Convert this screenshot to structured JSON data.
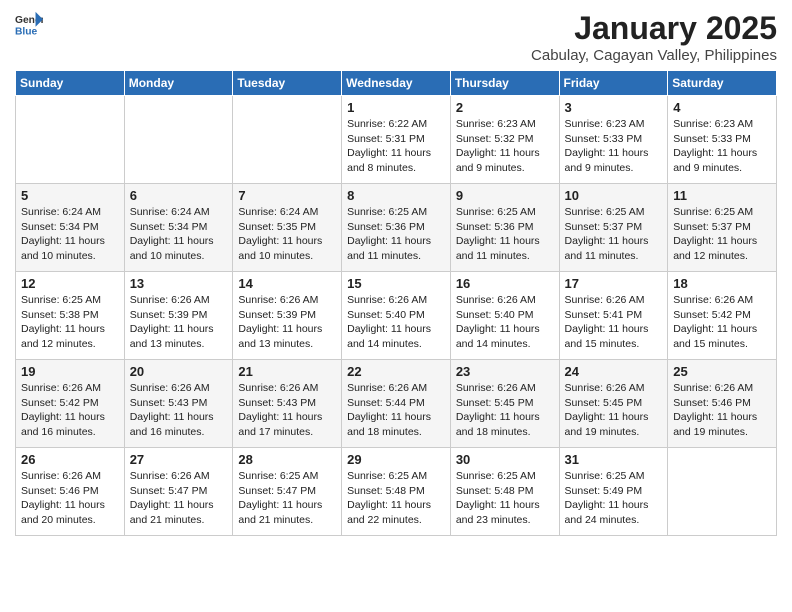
{
  "header": {
    "logo_line1": "General",
    "logo_line2": "Blue",
    "month": "January 2025",
    "location": "Cabulay, Cagayan Valley, Philippines"
  },
  "weekdays": [
    "Sunday",
    "Monday",
    "Tuesday",
    "Wednesday",
    "Thursday",
    "Friday",
    "Saturday"
  ],
  "weeks": [
    [
      {
        "day": "",
        "content": ""
      },
      {
        "day": "",
        "content": ""
      },
      {
        "day": "",
        "content": ""
      },
      {
        "day": "1",
        "content": "Sunrise: 6:22 AM\nSunset: 5:31 PM\nDaylight: 11 hours and 8 minutes."
      },
      {
        "day": "2",
        "content": "Sunrise: 6:23 AM\nSunset: 5:32 PM\nDaylight: 11 hours and 9 minutes."
      },
      {
        "day": "3",
        "content": "Sunrise: 6:23 AM\nSunset: 5:33 PM\nDaylight: 11 hours and 9 minutes."
      },
      {
        "day": "4",
        "content": "Sunrise: 6:23 AM\nSunset: 5:33 PM\nDaylight: 11 hours and 9 minutes."
      }
    ],
    [
      {
        "day": "5",
        "content": "Sunrise: 6:24 AM\nSunset: 5:34 PM\nDaylight: 11 hours and 10 minutes."
      },
      {
        "day": "6",
        "content": "Sunrise: 6:24 AM\nSunset: 5:34 PM\nDaylight: 11 hours and 10 minutes."
      },
      {
        "day": "7",
        "content": "Sunrise: 6:24 AM\nSunset: 5:35 PM\nDaylight: 11 hours and 10 minutes."
      },
      {
        "day": "8",
        "content": "Sunrise: 6:25 AM\nSunset: 5:36 PM\nDaylight: 11 hours and 11 minutes."
      },
      {
        "day": "9",
        "content": "Sunrise: 6:25 AM\nSunset: 5:36 PM\nDaylight: 11 hours and 11 minutes."
      },
      {
        "day": "10",
        "content": "Sunrise: 6:25 AM\nSunset: 5:37 PM\nDaylight: 11 hours and 11 minutes."
      },
      {
        "day": "11",
        "content": "Sunrise: 6:25 AM\nSunset: 5:37 PM\nDaylight: 11 hours and 12 minutes."
      }
    ],
    [
      {
        "day": "12",
        "content": "Sunrise: 6:25 AM\nSunset: 5:38 PM\nDaylight: 11 hours and 12 minutes."
      },
      {
        "day": "13",
        "content": "Sunrise: 6:26 AM\nSunset: 5:39 PM\nDaylight: 11 hours and 13 minutes."
      },
      {
        "day": "14",
        "content": "Sunrise: 6:26 AM\nSunset: 5:39 PM\nDaylight: 11 hours and 13 minutes."
      },
      {
        "day": "15",
        "content": "Sunrise: 6:26 AM\nSunset: 5:40 PM\nDaylight: 11 hours and 14 minutes."
      },
      {
        "day": "16",
        "content": "Sunrise: 6:26 AM\nSunset: 5:40 PM\nDaylight: 11 hours and 14 minutes."
      },
      {
        "day": "17",
        "content": "Sunrise: 6:26 AM\nSunset: 5:41 PM\nDaylight: 11 hours and 15 minutes."
      },
      {
        "day": "18",
        "content": "Sunrise: 6:26 AM\nSunset: 5:42 PM\nDaylight: 11 hours and 15 minutes."
      }
    ],
    [
      {
        "day": "19",
        "content": "Sunrise: 6:26 AM\nSunset: 5:42 PM\nDaylight: 11 hours and 16 minutes."
      },
      {
        "day": "20",
        "content": "Sunrise: 6:26 AM\nSunset: 5:43 PM\nDaylight: 11 hours and 16 minutes."
      },
      {
        "day": "21",
        "content": "Sunrise: 6:26 AM\nSunset: 5:43 PM\nDaylight: 11 hours and 17 minutes."
      },
      {
        "day": "22",
        "content": "Sunrise: 6:26 AM\nSunset: 5:44 PM\nDaylight: 11 hours and 18 minutes."
      },
      {
        "day": "23",
        "content": "Sunrise: 6:26 AM\nSunset: 5:45 PM\nDaylight: 11 hours and 18 minutes."
      },
      {
        "day": "24",
        "content": "Sunrise: 6:26 AM\nSunset: 5:45 PM\nDaylight: 11 hours and 19 minutes."
      },
      {
        "day": "25",
        "content": "Sunrise: 6:26 AM\nSunset: 5:46 PM\nDaylight: 11 hours and 19 minutes."
      }
    ],
    [
      {
        "day": "26",
        "content": "Sunrise: 6:26 AM\nSunset: 5:46 PM\nDaylight: 11 hours and 20 minutes."
      },
      {
        "day": "27",
        "content": "Sunrise: 6:26 AM\nSunset: 5:47 PM\nDaylight: 11 hours and 21 minutes."
      },
      {
        "day": "28",
        "content": "Sunrise: 6:25 AM\nSunset: 5:47 PM\nDaylight: 11 hours and 21 minutes."
      },
      {
        "day": "29",
        "content": "Sunrise: 6:25 AM\nSunset: 5:48 PM\nDaylight: 11 hours and 22 minutes."
      },
      {
        "day": "30",
        "content": "Sunrise: 6:25 AM\nSunset: 5:48 PM\nDaylight: 11 hours and 23 minutes."
      },
      {
        "day": "31",
        "content": "Sunrise: 6:25 AM\nSunset: 5:49 PM\nDaylight: 11 hours and 24 minutes."
      },
      {
        "day": "",
        "content": ""
      }
    ]
  ]
}
